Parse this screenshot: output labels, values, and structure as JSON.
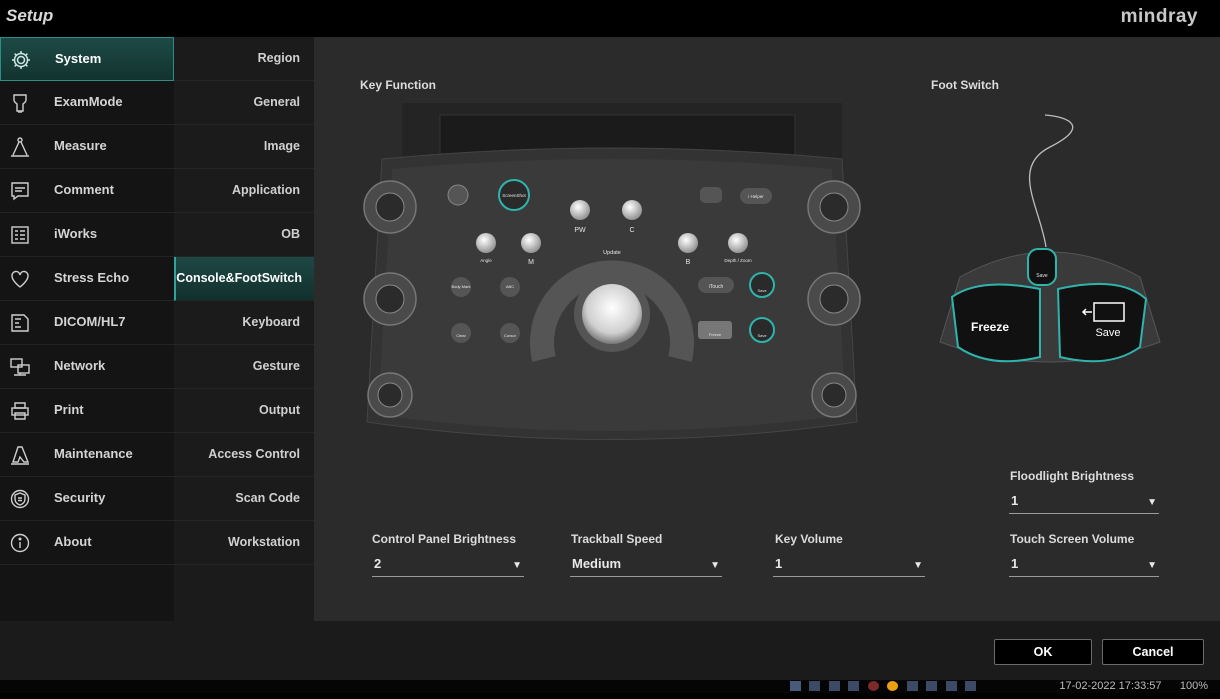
{
  "window": {
    "title": "Setup",
    "brand": "mindray"
  },
  "sidebar": {
    "items": [
      {
        "label": "System",
        "icon": "gear-icon",
        "active": true
      },
      {
        "label": "ExamMode",
        "icon": "probe-icon"
      },
      {
        "label": "Measure",
        "icon": "caliper-icon"
      },
      {
        "label": "Comment",
        "icon": "comment-icon"
      },
      {
        "label": "iWorks",
        "icon": "list-icon"
      },
      {
        "label": "Stress Echo",
        "icon": "heart-icon"
      },
      {
        "label": "DICOM/HL7",
        "icon": "dicom-icon"
      },
      {
        "label": "Network",
        "icon": "network-icon"
      },
      {
        "label": "Print",
        "icon": "printer-icon"
      },
      {
        "label": "Maintenance",
        "icon": "wrench-icon"
      },
      {
        "label": "Security",
        "icon": "shield-icon"
      },
      {
        "label": "About",
        "icon": "info-icon"
      }
    ]
  },
  "subnav": {
    "items": [
      {
        "label": "Region"
      },
      {
        "label": "General"
      },
      {
        "label": "Image"
      },
      {
        "label": "Application"
      },
      {
        "label": "OB"
      },
      {
        "label": "Console&FootSwitch",
        "active": true
      },
      {
        "label": "Keyboard"
      },
      {
        "label": "Gesture"
      },
      {
        "label": "Output"
      },
      {
        "label": "Access Control"
      },
      {
        "label": "Scan Code"
      },
      {
        "label": "Workstation"
      }
    ]
  },
  "content": {
    "key_function_title": "Key Function",
    "foot_switch_title": "Foot Switch",
    "console_labels": {
      "screenshot": "ScreenShot",
      "ihelper": "i Helper",
      "pw": "PW",
      "c": "C",
      "angle": "Angle",
      "m": "M",
      "b": "B",
      "depth_zoom": "Depth / Zoom",
      "update": "Update",
      "body_mark": "Body Mark",
      "abc": "ABC",
      "clear": "Clear",
      "cursor": "Cursor",
      "itouch": "iTouch",
      "save": "Save",
      "freeze": "Freeze"
    },
    "foot_switch": {
      "left_label": "Freeze",
      "right_label": "Save",
      "top_label": "Save"
    },
    "floodlight": {
      "label": "Floodlight Brightness",
      "value": "1"
    },
    "fields": [
      {
        "label": "Control Panel Brightness",
        "value": "2"
      },
      {
        "label": "Trackball Speed",
        "value": "Medium"
      },
      {
        "label": "Key Volume",
        "value": "1"
      },
      {
        "label": "Touch Screen Volume",
        "value": "1"
      }
    ]
  },
  "footer": {
    "ok_label": "OK",
    "cancel_label": "Cancel"
  },
  "status": {
    "datetime": "17-02-2022 17:33:57",
    "zoom": "100%"
  },
  "colors": {
    "accent": "#2c8e88",
    "content_bg": "#2b2b2b",
    "sidebar_bg": "#141414"
  }
}
